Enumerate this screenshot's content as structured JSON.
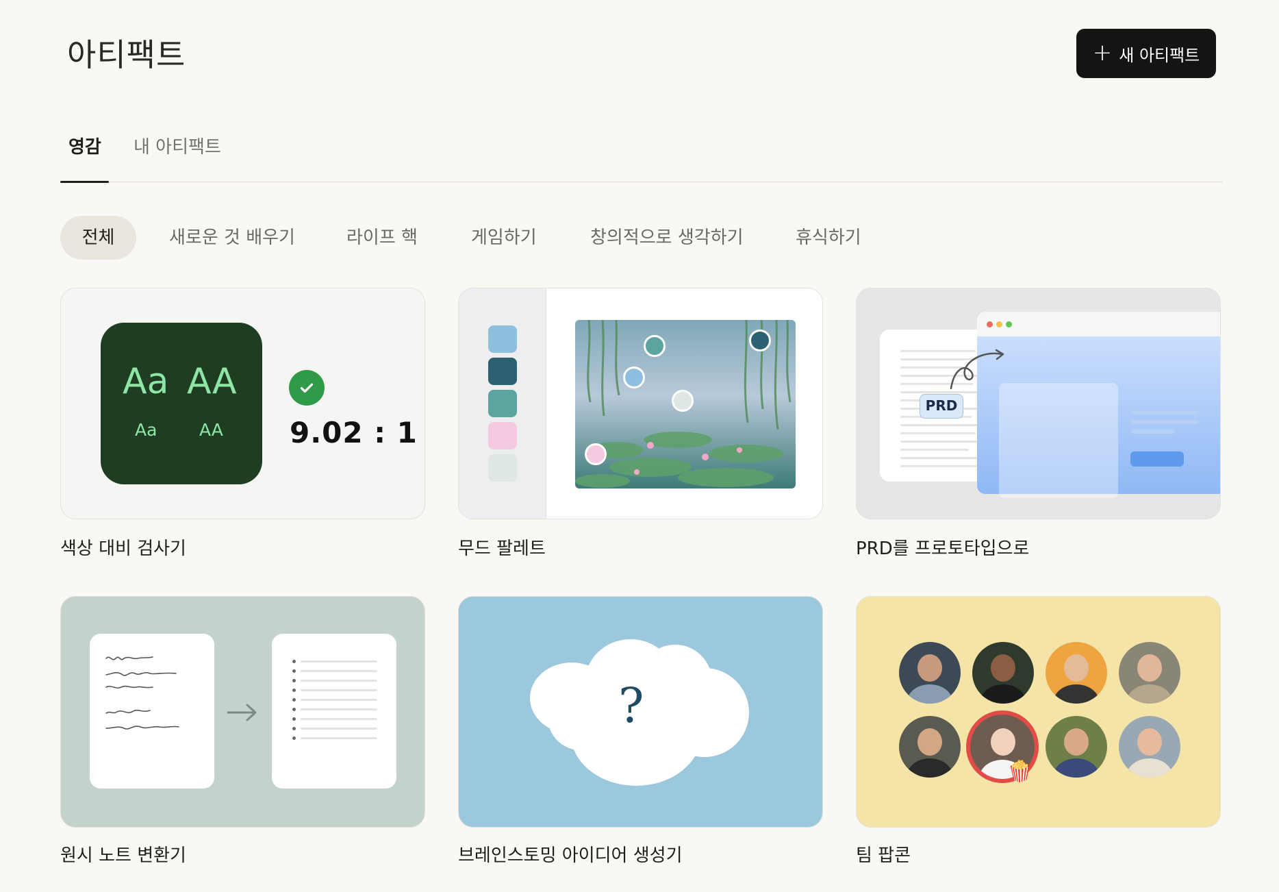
{
  "header": {
    "title": "아티팩트",
    "new_button": {
      "icon": "plus-icon",
      "label": "새 아티팩트"
    }
  },
  "tabs": [
    {
      "label": "영감",
      "active": true
    },
    {
      "label": "내 아티팩트",
      "active": false
    }
  ],
  "filters": [
    {
      "label": "전체",
      "selected": true
    },
    {
      "label": "새로운 것 배우기",
      "selected": false
    },
    {
      "label": "라이프 핵",
      "selected": false
    },
    {
      "label": "게임하기",
      "selected": false
    },
    {
      "label": "창의적으로 생각하기",
      "selected": false
    },
    {
      "label": "휴식하기",
      "selected": false
    }
  ],
  "cards": [
    {
      "title": "색상 대비 검사기",
      "preview": {
        "sample_large": [
          "Aa",
          "AA"
        ],
        "sample_small": [
          "Aa",
          "AA"
        ],
        "ratio": "9.02 : 1",
        "swatch_color": "#1e3d22",
        "text_color": "#8ee6a6",
        "status_icon": "check-icon"
      }
    },
    {
      "title": "무드 팔레트",
      "preview": {
        "palette": [
          "#8fbfde",
          "#2b6170",
          "#5aa5a0",
          "#f5c9df",
          "#dfe6e6"
        ]
      }
    },
    {
      "title": "PRD를 프로토타입으로",
      "preview": {
        "tag": "PRD",
        "icon": "curved-arrow-icon"
      }
    },
    {
      "title": "원시 노트 변환기",
      "preview": {
        "icon": "arrow-right-icon"
      }
    },
    {
      "title": "브레인스토밍 아이디어 생성기",
      "preview": {
        "symbol": "?"
      }
    },
    {
      "title": "팀 팝콘",
      "preview": {
        "icon": "popcorn-icon",
        "popcorn": "🍿"
      }
    }
  ],
  "colors": {
    "background": "#f9f8f5",
    "primary_button": "#141413",
    "chip_selected": "#e9e6de"
  }
}
